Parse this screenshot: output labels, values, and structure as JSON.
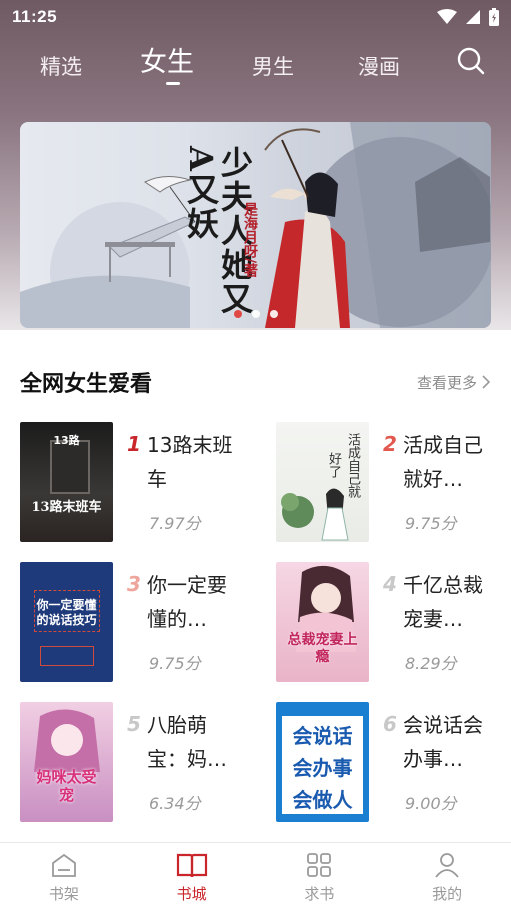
{
  "status_bar": {
    "time": "11:25"
  },
  "top_tabs": [
    {
      "label": "精选"
    },
    {
      "label": "女生"
    },
    {
      "label": "男生"
    },
    {
      "label": "漫画"
    }
  ],
  "banner": {
    "title": "少夫人她又A又妖",
    "author": "是海月呀/著"
  },
  "section": {
    "title": "全网女生爱看",
    "more_label": "查看更多"
  },
  "books": [
    {
      "rank": "1",
      "name": "13路末班车",
      "score": "7.97分",
      "rank_color": "#c9262c",
      "cover_text": "13路末班车",
      "cover_top": "13路"
    },
    {
      "rank": "2",
      "name": "活成自己就好…",
      "score": "9.75分",
      "rank_color": "#e2584f",
      "cover_text": "活成自己就好了"
    },
    {
      "rank": "3",
      "name": "你一定要懂的…",
      "score": "9.75分",
      "rank_color": "#eea59c",
      "cover_text": "你一定要懂的说话技巧"
    },
    {
      "rank": "4",
      "name": "千亿总裁宠妻…",
      "score": "8.29分",
      "rank_color": "#c8c8c8",
      "cover_text": "总裁宠妻上瘾"
    },
    {
      "rank": "5",
      "name": "八胎萌宝：妈…",
      "score": "6.34分",
      "rank_color": "#c8c8c8",
      "cover_text": "妈咪太受宠"
    },
    {
      "rank": "6",
      "name": "会说话会办事…",
      "score": "9.00分",
      "rank_color": "#c8c8c8",
      "cover_text": "会说话会办事会做人"
    }
  ],
  "bottom_nav": [
    {
      "label": "书架"
    },
    {
      "label": "书城"
    },
    {
      "label": "求书"
    },
    {
      "label": "我的"
    }
  ],
  "colors": {
    "accent": "#c9262c",
    "inactive": "#9a9a9a"
  }
}
